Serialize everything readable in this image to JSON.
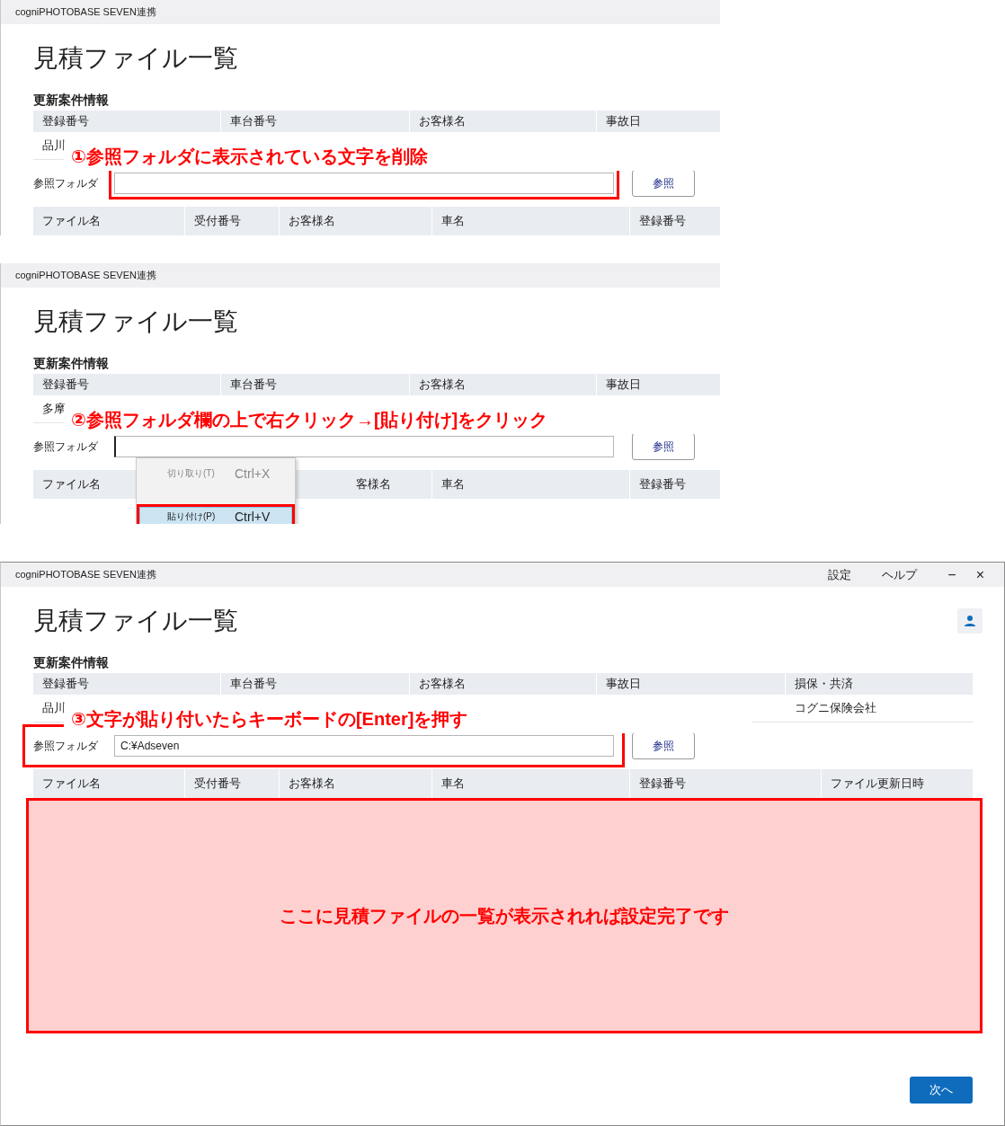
{
  "panels": [
    {
      "window": {
        "title": "cogniPHOTOBASE SEVEN連携"
      },
      "page_title": "見積ファイル一覧",
      "section_title": "更新案件情報",
      "info_table": {
        "columns": [
          "登録番号",
          "車台番号",
          "お客様名",
          "事故日"
        ],
        "row_start": "品川"
      },
      "folder": {
        "label": "参照フォルダ",
        "browse_button": "参照",
        "highlight_input": true,
        "highlight_row": false
      },
      "file_table": {
        "columns": [
          {
            "label": "ファイル名"
          },
          {
            "label": "受付番号"
          },
          {
            "label": "お客様名"
          },
          {
            "label": "車名"
          },
          {
            "label": "登録番号"
          }
        ]
      },
      "annotation": "①参照フォルダに表示されている文字を削除"
    },
    {
      "window": {
        "title": "cogniPHOTOBASE SEVEN連携"
      },
      "page_title": "見積ファイル一覧",
      "section_title": "更新案件情報",
      "info_table": {
        "columns": [
          "登録番号",
          "車台番号",
          "お客様名",
          "事故日"
        ],
        "row_start": "多摩"
      },
      "folder": {
        "label": "参照フォルダ",
        "browse_button": "参照",
        "caret": true,
        "highlight_input": false,
        "highlight_row": false
      },
      "file_table": {
        "columns": [
          {
            "label": "ファイル名"
          },
          {
            "label": "客様名"
          },
          {
            "label": "車名"
          },
          {
            "label": "登録番号"
          }
        ]
      },
      "context_menu": [
        {
          "label": "切り取り(T)",
          "shortcut": "Ctrl+X",
          "selected": false,
          "highlighted": false
        },
        {
          "label": "貼り付け(P)",
          "shortcut": "Ctrl+V",
          "selected": true,
          "highlighted": true
        }
      ],
      "annotation": "②参照フォルダ欄の上で右クリック→[貼り付け]をクリック"
    },
    {
      "window": {
        "title": "cogniPHOTOBASE SEVEN連携",
        "menu": [
          "設定",
          "ヘルプ"
        ],
        "controls": [
          "−",
          "×"
        ]
      },
      "page_title": "見積ファイル一覧",
      "section_title": "更新案件情報",
      "user_button": true,
      "info_table": {
        "columns": [
          "登録番号",
          "車台番号",
          "お客様名",
          "事故日",
          "損保・共済"
        ],
        "row_start": "品川",
        "row_end": "コグニ保険会社"
      },
      "folder": {
        "label": "参照フォルダ",
        "value": "C:¥Adseven",
        "browse_button": "参照",
        "highlight_input": false,
        "highlight_row": true
      },
      "file_table": {
        "columns": [
          {
            "label": "ファイル名"
          },
          {
            "label": "受付番号"
          },
          {
            "label": "お客様名"
          },
          {
            "label": "車名"
          },
          {
            "label": "登録番号"
          },
          {
            "label": "ファイル更新日時"
          }
        ]
      },
      "annotation": "③文字が貼り付いたらキーボードの[Enter]を押す",
      "result_note": "ここに見積ファイルの一覧が表示されれば設定完了です",
      "next_button": "次へ"
    }
  ]
}
